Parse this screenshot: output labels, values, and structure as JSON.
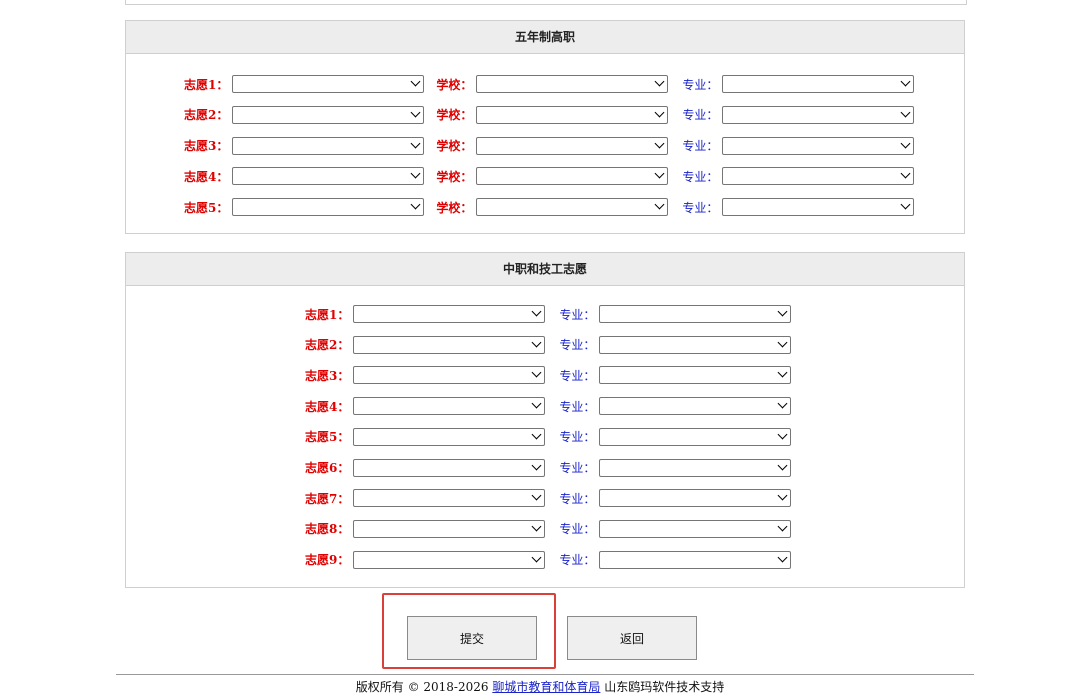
{
  "five_year": {
    "title": "五年制高职",
    "rows": [
      {
        "label": "志愿1",
        "school_label": "学校",
        "major_label": "专业"
      },
      {
        "label": "志愿2",
        "school_label": "学校",
        "major_label": "专业"
      },
      {
        "label": "志愿3",
        "school_label": "学校",
        "major_label": "专业"
      },
      {
        "label": "志愿4",
        "school_label": "学校",
        "major_label": "专业"
      },
      {
        "label": "志愿5",
        "school_label": "学校",
        "major_label": "专业"
      }
    ]
  },
  "vocational": {
    "title": "中职和技工志愿",
    "rows": [
      {
        "label": "志愿1",
        "major_label": "专业"
      },
      {
        "label": "志愿2",
        "major_label": "专业"
      },
      {
        "label": "志愿3",
        "major_label": "专业"
      },
      {
        "label": "志愿4",
        "major_label": "专业"
      },
      {
        "label": "志愿5",
        "major_label": "专业"
      },
      {
        "label": "志愿6",
        "major_label": "专业"
      },
      {
        "label": "志愿7",
        "major_label": "专业"
      },
      {
        "label": "志愿8",
        "major_label": "专业"
      },
      {
        "label": "志愿9",
        "major_label": "专业"
      }
    ]
  },
  "colon": "：",
  "buttons": {
    "submit": "提交",
    "back": "返回"
  },
  "footer": {
    "prefix": "版权所有 © 2018-2026",
    "link": "聊城市教育和体育局",
    "suffix": "山东鸥玛软件技术支持"
  },
  "colors": {
    "required_label": "#e00000",
    "optional_label": "#1a23c8",
    "highlight": "#d9403a"
  }
}
